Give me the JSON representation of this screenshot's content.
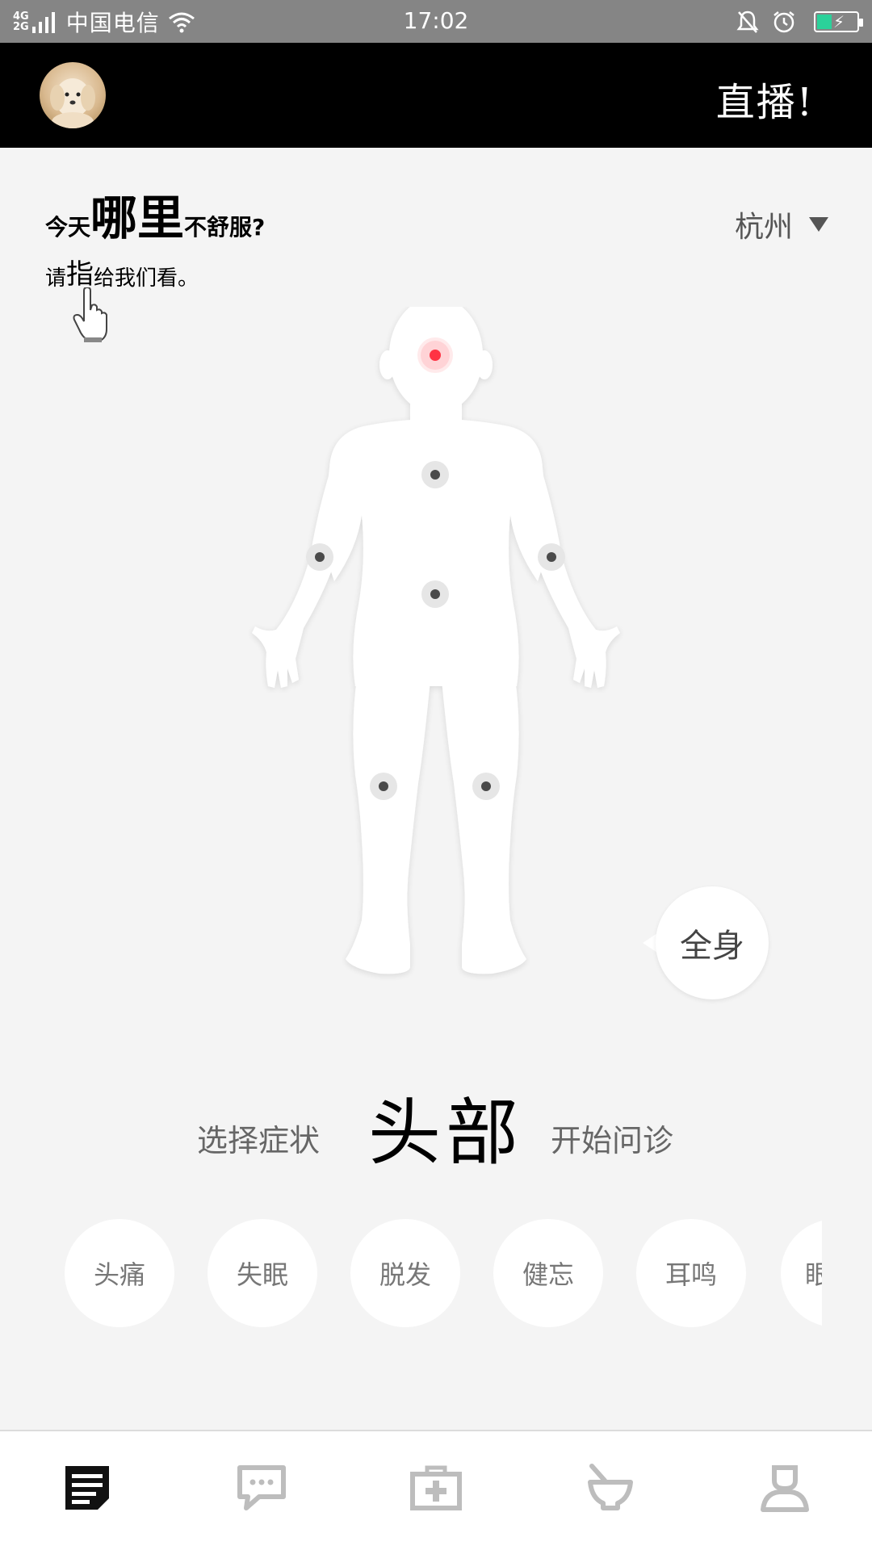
{
  "status_bar": {
    "network_top": "4G",
    "network_bottom": "2G",
    "carrier": "中国电信",
    "time": "17:02"
  },
  "header": {
    "title": "直播!"
  },
  "question": {
    "line1_prefix": "今天",
    "line1_emphasis": "哪里",
    "line1_suffix": "不舒服?",
    "line2_prefix": "请",
    "line2_emphasis": "指",
    "line2_suffix": "给我们看。"
  },
  "location": {
    "city": "杭州"
  },
  "whole_body_button": "全身",
  "part_selector": {
    "left_label": "选择症状",
    "current_part": "头部",
    "right_label": "开始问诊"
  },
  "symptoms": [
    "头痛",
    "失眠",
    "脱发",
    "健忘",
    "耳鸣",
    "眼"
  ],
  "body_points": [
    {
      "name": "head",
      "active": true
    },
    {
      "name": "chest",
      "active": false
    },
    {
      "name": "left-arm",
      "active": false
    },
    {
      "name": "right-arm",
      "active": false
    },
    {
      "name": "abdomen",
      "active": false
    },
    {
      "name": "left-knee",
      "active": false
    },
    {
      "name": "right-knee",
      "active": false
    }
  ],
  "bottom_nav": [
    {
      "icon": "article-icon",
      "active": true
    },
    {
      "icon": "chat-icon",
      "active": false
    },
    {
      "icon": "medical-kit-icon",
      "active": false
    },
    {
      "icon": "mortar-icon",
      "active": false
    },
    {
      "icon": "doctor-icon",
      "active": false
    }
  ],
  "colors": {
    "status_bar": "#858585",
    "header": "#000000",
    "background": "#f4f4f4",
    "active_point": "#ff3344",
    "battery": "#2bd19a"
  }
}
